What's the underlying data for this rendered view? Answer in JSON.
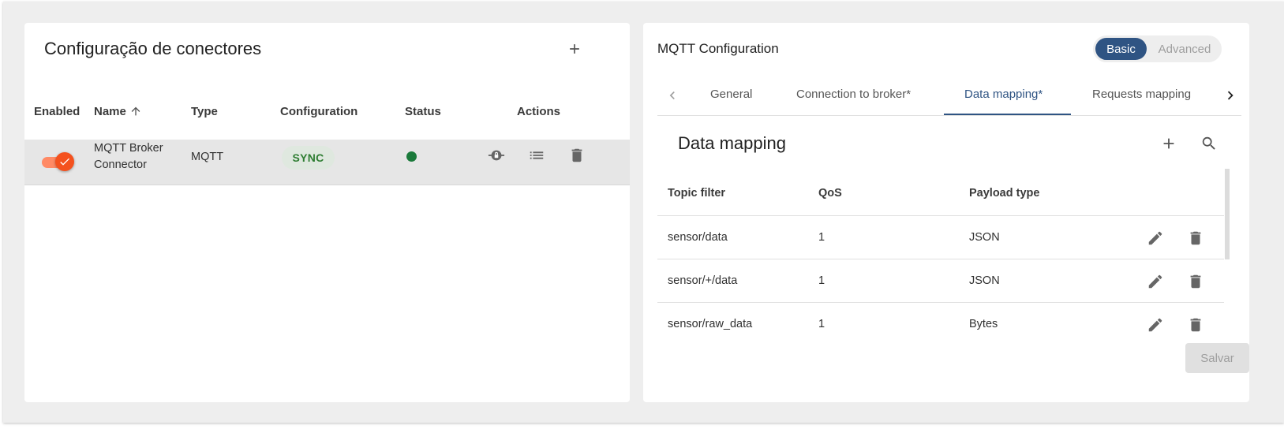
{
  "connectors_panel": {
    "title": "Configuração de conectores",
    "columns": {
      "enabled": "Enabled",
      "name": "Name",
      "type": "Type",
      "configuration": "Configuration",
      "status": "Status",
      "actions": "Actions"
    },
    "sort": {
      "column": "Name",
      "direction": "ascending"
    },
    "rows": [
      {
        "enabled": true,
        "name_line1": "MQTT Broker",
        "name_line2": "Connector",
        "type": "MQTT",
        "configuration": "SYNC",
        "status_color": "#1b7a3b",
        "selected": true
      }
    ]
  },
  "config_panel": {
    "title": "MQTT Configuration",
    "mode_toggle": {
      "options": [
        "Basic",
        "Advanced"
      ],
      "selected": "Basic"
    },
    "tabs": [
      {
        "label": "General",
        "active": false
      },
      {
        "label": "Connection to broker*",
        "active": false
      },
      {
        "label": "Data mapping*",
        "active": true
      },
      {
        "label": "Requests mapping",
        "active": false
      }
    ],
    "section": {
      "title": "Data mapping",
      "columns": {
        "topic_filter": "Topic filter",
        "qos": "QoS",
        "payload_type": "Payload type"
      },
      "rows": [
        {
          "topic_filter": "sensor/data",
          "qos": "1",
          "payload_type": "JSON"
        },
        {
          "topic_filter": "sensor/+/data",
          "qos": "1",
          "payload_type": "JSON"
        },
        {
          "topic_filter": "sensor/raw_data",
          "qos": "1",
          "payload_type": "Bytes"
        }
      ]
    },
    "save_label": "Salvar"
  },
  "colors": {
    "accent": "#2f5483",
    "toggle_on": "#f4511e",
    "sync_text": "#2e7d32",
    "status_ok": "#1b7a3b"
  },
  "icons": {
    "add": "plus-icon",
    "sort": "arrow-up-icon",
    "remote_logs": "lock-icon",
    "logs": "list-icon",
    "delete": "delete-icon",
    "edit": "pencil-icon",
    "search": "search-icon",
    "tabs_prev": "chevron-left-icon",
    "tabs_next": "chevron-right-icon",
    "toggle_check": "check-icon"
  }
}
